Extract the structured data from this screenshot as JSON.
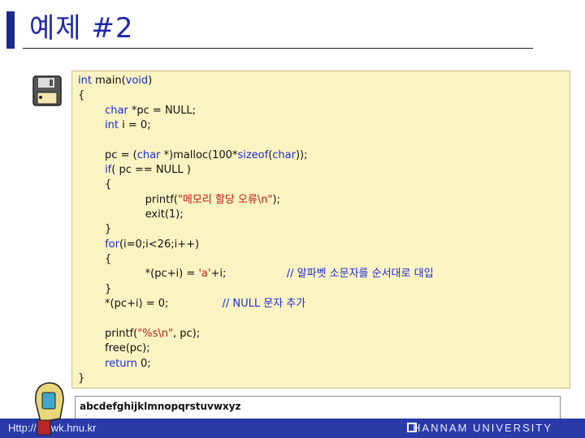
{
  "slide": {
    "title": "예제 #2"
  },
  "code": {
    "lines": [
      [
        {
          "t": "int",
          "c": "kw"
        },
        {
          "t": " main(",
          "c": ""
        },
        {
          "t": "void",
          "c": "kw"
        },
        {
          "t": ")",
          "c": ""
        }
      ],
      [
        {
          "t": "{",
          "c": ""
        }
      ],
      [
        {
          "t": "        ",
          "c": ""
        },
        {
          "t": "char",
          "c": "kw"
        },
        {
          "t": " *pc = NULL;",
          "c": ""
        }
      ],
      [
        {
          "t": "        ",
          "c": ""
        },
        {
          "t": "int",
          "c": "kw"
        },
        {
          "t": " i = 0;",
          "c": ""
        }
      ],
      [
        {
          "t": "",
          "c": ""
        }
      ],
      [
        {
          "t": "        pc = (",
          "c": ""
        },
        {
          "t": "char",
          "c": "kw"
        },
        {
          "t": " *)malloc(100*",
          "c": ""
        },
        {
          "t": "sizeof",
          "c": "kw"
        },
        {
          "t": "(",
          "c": ""
        },
        {
          "t": "char",
          "c": "kw"
        },
        {
          "t": "));",
          "c": ""
        }
      ],
      [
        {
          "t": "        ",
          "c": ""
        },
        {
          "t": "if",
          "c": "kw"
        },
        {
          "t": "( pc == NULL )",
          "c": ""
        }
      ],
      [
        {
          "t": "        {",
          "c": ""
        }
      ],
      [
        {
          "t": "                    printf(",
          "c": ""
        },
        {
          "t": "\"메모리 할당 오류\\n\"",
          "c": "str"
        },
        {
          "t": ");",
          "c": ""
        }
      ],
      [
        {
          "t": "                    exit(1);",
          "c": ""
        }
      ],
      [
        {
          "t": "        }",
          "c": ""
        }
      ],
      [
        {
          "t": "        ",
          "c": ""
        },
        {
          "t": "for",
          "c": "kw"
        },
        {
          "t": "(i=0;i<26;i++)",
          "c": ""
        }
      ],
      [
        {
          "t": "        {",
          "c": ""
        }
      ],
      [
        {
          "t": "                    *(pc+i) = ",
          "c": ""
        },
        {
          "t": "'a'",
          "c": "str"
        },
        {
          "t": "+i;                  ",
          "c": ""
        },
        {
          "t": "// 알파벳 소문자를 순서대로 대입",
          "c": "cmt"
        }
      ],
      [
        {
          "t": "        }",
          "c": ""
        }
      ],
      [
        {
          "t": "        *(pc+i) = 0;                ",
          "c": ""
        },
        {
          "t": "// NULL 문자 추가",
          "c": "cmt"
        }
      ],
      [
        {
          "t": "",
          "c": ""
        }
      ],
      [
        {
          "t": "        printf(",
          "c": ""
        },
        {
          "t": "\"%s\\n\"",
          "c": "str"
        },
        {
          "t": ", pc);",
          "c": ""
        }
      ],
      [
        {
          "t": "        free(pc);",
          "c": ""
        }
      ],
      [
        {
          "t": "        ",
          "c": ""
        },
        {
          "t": "return",
          "c": "kw"
        },
        {
          "t": " 0;",
          "c": ""
        }
      ],
      [
        {
          "t": "}",
          "c": ""
        }
      ]
    ]
  },
  "output": {
    "text": "abcdefghijklmnopqrstuvwxyz"
  },
  "footer": {
    "url": "Http://netwk.hnu.kr",
    "university": "HANNAM UNIVERSITY"
  },
  "colors": {
    "title": "#1f2aa8",
    "keyword": "#1a2bd8",
    "string": "#c01818",
    "panel": "#fbf3c2",
    "footer": "#2a3aa8"
  },
  "icons": {
    "disk": "floppy-disk-icon",
    "person": "computer-person-icon",
    "logo": "university-logo-icon"
  }
}
